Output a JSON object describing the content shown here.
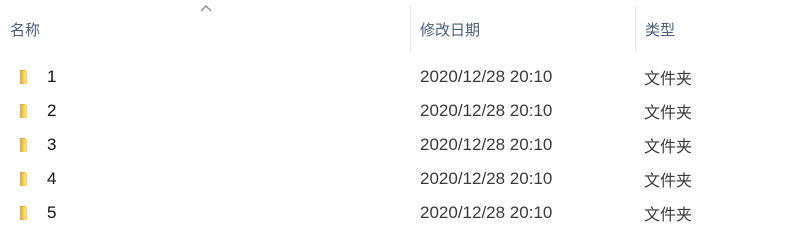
{
  "columns": {
    "name": "名称",
    "date": "修改日期",
    "type": "类型"
  },
  "sort": {
    "column": "name",
    "direction": "ascending",
    "icon": "chevron-up-icon"
  },
  "folder_icon": "folder-icon",
  "colors": {
    "header_text": "#4c607a",
    "folder_front": "#f8d775",
    "folder_back": "#e0b13c"
  },
  "files": [
    {
      "name": "1",
      "modified": "2020/12/28 20:10",
      "type": "文件夹"
    },
    {
      "name": "2",
      "modified": "2020/12/28 20:10",
      "type": "文件夹"
    },
    {
      "name": "3",
      "modified": "2020/12/28 20:10",
      "type": "文件夹"
    },
    {
      "name": "4",
      "modified": "2020/12/28 20:10",
      "type": "文件夹"
    },
    {
      "name": "5",
      "modified": "2020/12/28 20:10",
      "type": "文件夹"
    }
  ]
}
